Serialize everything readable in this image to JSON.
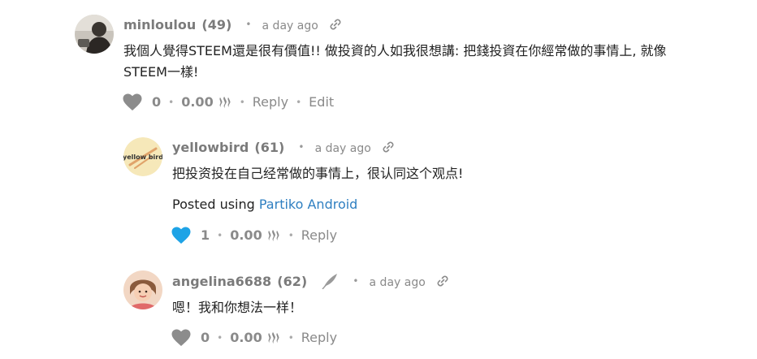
{
  "comments": [
    {
      "author": "minloulou",
      "reputation": "(49)",
      "time": "a day ago",
      "body_line1": "我個人覺得STEEM還是很有價值!! 做投資的人如我很想講: 把錢投資在你經常做的事情上, 就像",
      "body_line2": "STEEM一樣!",
      "votes": "0",
      "payout": "0.00",
      "reply_label": "Reply",
      "edit_label": "Edit",
      "heart_color": "#8c8c8c"
    },
    {
      "author": "yellowbird",
      "reputation": "(61)",
      "time": "a day ago",
      "avatar_text": "yellow bird",
      "body_line1": "把投资投在自己经常做的事情上，很认同这个观点!",
      "posted_prefix": "Posted using",
      "posted_app": "Partiko Android",
      "votes": "1",
      "payout": "0.00",
      "reply_label": "Reply",
      "heart_color": "#1ea3e6"
    },
    {
      "author": "angelina6688",
      "reputation": "(62)",
      "time": "a day ago",
      "body_line1": "嗯！我和你想法一样！",
      "votes": "0",
      "payout": "0.00",
      "reply_label": "Reply",
      "heart_color": "#8c8c8c"
    }
  ],
  "separator": "•",
  "link_color": "#2f7fc1"
}
